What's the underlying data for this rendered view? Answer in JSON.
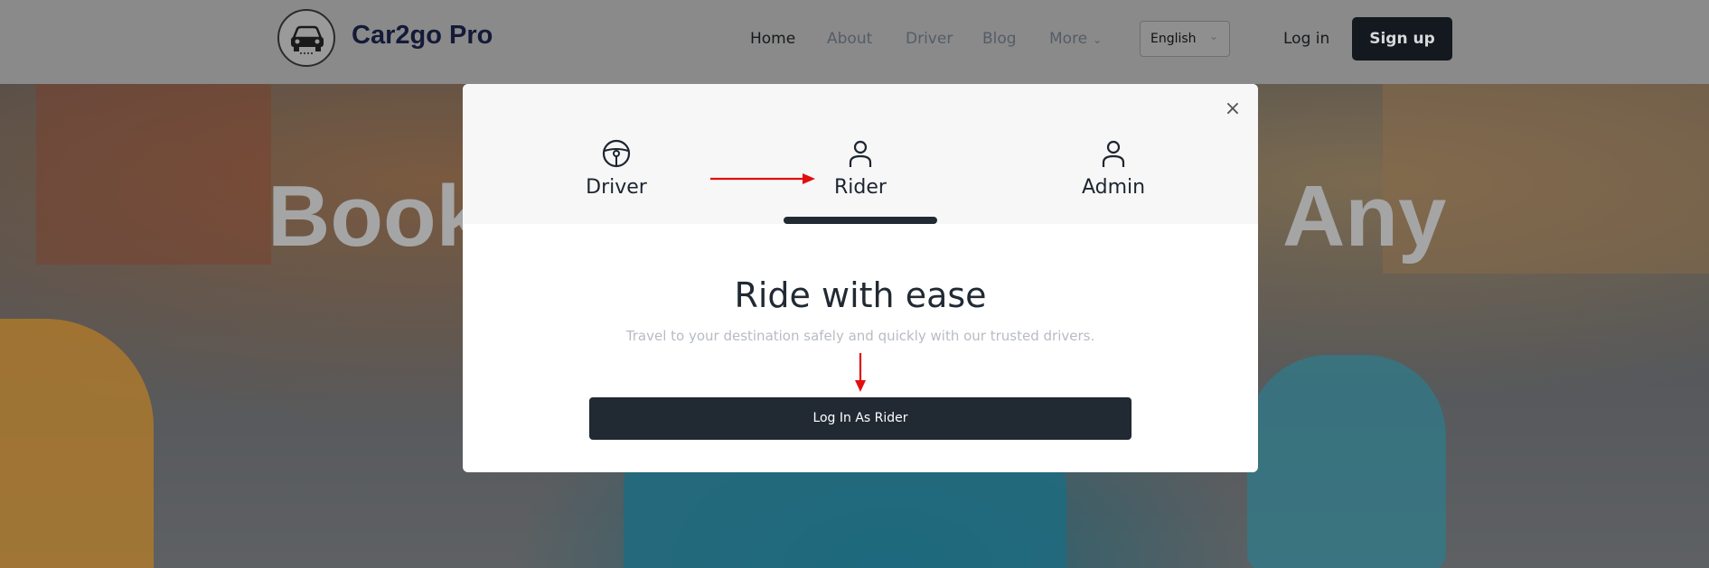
{
  "header": {
    "brand": "Car2go Pro",
    "nav": {
      "home": "Home",
      "about": "About",
      "driver": "Driver",
      "blog": "Blog",
      "more": "More"
    },
    "language": "English",
    "login_label": "Log in",
    "signup_label": "Sign up"
  },
  "hero": {
    "word_left": "Book",
    "word_right": "Any"
  },
  "modal": {
    "tabs": [
      {
        "label": "Driver",
        "icon": "steering-wheel-icon"
      },
      {
        "label": "Rider",
        "icon": "user-icon"
      },
      {
        "label": "Admin",
        "icon": "user-icon"
      }
    ],
    "active_tab": "Rider",
    "title": "Ride with ease",
    "subtitle": "Travel to your destination safely and quickly with our trusted drivers.",
    "button_label": "Log In As Rider"
  },
  "colors": {
    "brand_dark": "#212a33",
    "annotation_arrow": "#e01010"
  }
}
